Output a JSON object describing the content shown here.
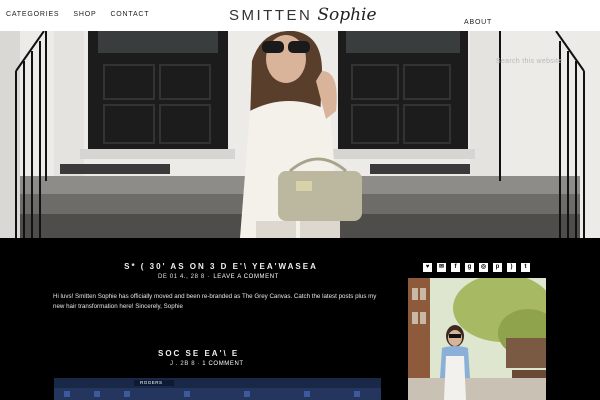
{
  "header": {
    "nav_left": [
      "CATEGORIES",
      "SHOP",
      "CONTACT"
    ],
    "logo_main": "SMITTEN",
    "logo_script": "Sophie",
    "nav_right": "ABOUT"
  },
  "hero": {
    "search_placeholder": "Search this website"
  },
  "post1": {
    "title": "S*   ( 30'     AS  ON   3  D     E'\\ YEA'WASEA",
    "date": "DE 01 4., 28 8",
    "comment": "LEAVE A COMMENT",
    "body": "Hi luvs! Smitten Sophie has officially moved and been re-branded as The Grey Canvas. Catch the latest posts plus my new hair transformation here! Sincerely, Sophie"
  },
  "post2": {
    "title": "SOC  SE EA'\\        E  ",
    "date": "J  . 2B 8",
    "comment": "1 COMMENT",
    "banner_text": "ROGERS"
  },
  "sidebar": {
    "social_icons": [
      "heart-icon",
      "email-icon",
      "facebook-icon",
      "google-plus-icon",
      "instagram-icon",
      "pinterest-icon",
      "rss-icon",
      "twitter-icon"
    ]
  },
  "colors": {
    "background": "#000000",
    "header_bg": "#ffffff",
    "text_light": "#e6e6e6"
  }
}
